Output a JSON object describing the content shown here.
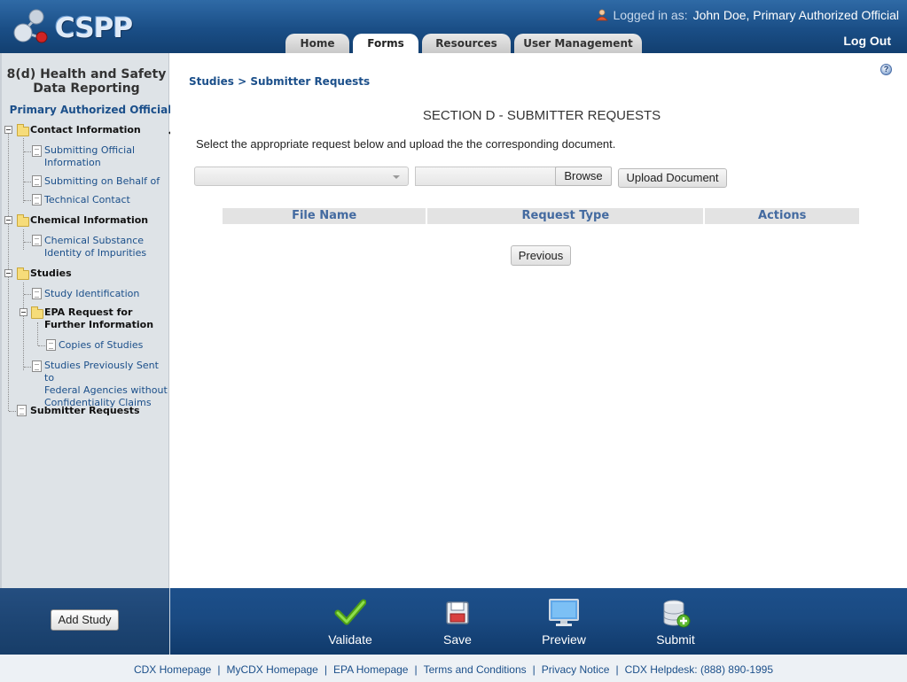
{
  "header": {
    "logo_text": "CSPP",
    "login_label": "Logged in as:",
    "login_user": "John Doe, Primary Authorized Official",
    "logout": "Log Out",
    "tabs": [
      {
        "label": "Home",
        "active": false
      },
      {
        "label": "Forms",
        "active": true
      },
      {
        "label": "Resources",
        "active": false
      },
      {
        "label": "User Management",
        "active": false
      }
    ]
  },
  "sidebar": {
    "title_line1": "8(d) Health and Safety",
    "title_line2": "Data Reporting",
    "role": "Primary Authorized Official",
    "tree": {
      "contact_information": "Contact Information",
      "submitting_official_1": "Submitting Official",
      "submitting_official_2": "Information",
      "submitting_on_behalf": "Submitting on Behalf of",
      "technical_contact": "Technical Contact",
      "chemical_information": "Chemical Information",
      "chemical_substance_1": "Chemical Substance",
      "chemical_substance_2": "Identity of Impurities",
      "studies": "Studies",
      "study_identification": "Study Identification",
      "epa_request_1": "EPA Request for",
      "epa_request_2": "Further Information",
      "copies_of_studies": "Copies of Studies",
      "studies_prev_1": "Studies Previously Sent to",
      "studies_prev_2": "Federal Agencies without",
      "studies_prev_3": "Confidentiality Claims",
      "submitter_requests": "Submitter Requests"
    }
  },
  "main": {
    "breadcrumb_parent": "Studies",
    "breadcrumb_separator": ">",
    "breadcrumb_current": "Submitter Requests",
    "section_title": "SECTION D - SUBMITTER REQUESTS",
    "instructions": "Select the appropriate request below and upload the the corresponding document.",
    "request_select_value": "",
    "file_path_value": "",
    "browse_label": "Browse",
    "upload_label": "Upload Document",
    "table_headers": [
      "File Name",
      "Request Type",
      "Actions"
    ],
    "previous_label": "Previous",
    "help_glyph": "?"
  },
  "actions": {
    "add_study": "Add Study",
    "validate": "Validate",
    "save": "Save",
    "preview": "Preview",
    "submit": "Submit"
  },
  "footer": {
    "links": [
      "CDX Homepage",
      "MyCDX Homepage",
      "EPA Homepage",
      "Terms and Conditions",
      "Privacy Notice",
      "CDX Helpdesk: (888) 890-1995"
    ],
    "separator": "|"
  },
  "colors": {
    "header_blue": "#1a4e86",
    "link_blue": "#1b4f8a",
    "sidebar_bg": "#dee3e7",
    "validate_check_green": "#6cc12a"
  },
  "icons": {
    "logo": "molecule-logo-icon",
    "user": "user-icon",
    "help": "help-icon",
    "validate": "checkmark-icon",
    "save": "floppy-disk-icon",
    "preview": "monitor-icon",
    "submit": "database-add-icon"
  }
}
